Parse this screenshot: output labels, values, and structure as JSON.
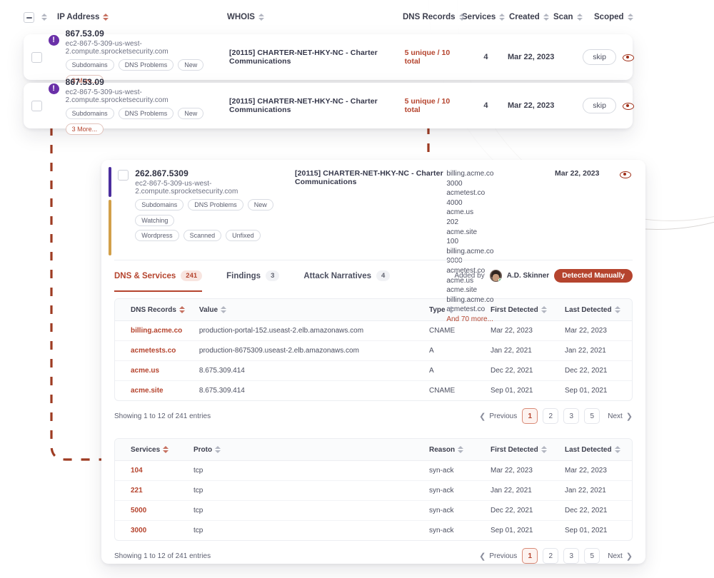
{
  "table_header": {
    "select_all_checkbox": "indeterminate",
    "columns": [
      {
        "label": "IP Address",
        "sort": "sortable-red"
      },
      {
        "label": "WHOIS",
        "sort": "sortable"
      },
      {
        "label": "DNS Records",
        "sort": "sortable"
      },
      {
        "label": "Services",
        "sort": "sortable"
      },
      {
        "label": "Created",
        "sort": "sortable"
      },
      {
        "label": "Scan",
        "sort": "sortable"
      },
      {
        "label": "Scoped",
        "sort": "sortable"
      }
    ]
  },
  "rows": [
    {
      "ip": "867.53.09",
      "hostname": "ec2-867-5-309-us-west-2.compute.sprocketsecurity.com",
      "tags": [
        "Subdomains",
        "DNS Problems",
        "New"
      ],
      "more_tag": "3 More...",
      "whois": "[20115] CHARTER-NET-HKY-NC - Charter Communications",
      "dns_records": "5 unique / 10 total",
      "services": "4",
      "created": "Mar 22, 2023",
      "scan": "skip",
      "scoped_icon": "eye-icon"
    },
    {
      "ip": "867.53.09",
      "hostname": "ec2-867-5-309-us-west-2.compute.sprocketsecurity.com",
      "tags": [
        "Subdomains",
        "DNS Problems",
        "New"
      ],
      "more_tag": "3 More...",
      "whois": "[20115] CHARTER-NET-HKY-NC - Charter Communications",
      "dns_records": "5 unique / 10 total",
      "services": "4",
      "created": "Mar 22, 2023",
      "scan": "skip",
      "scoped_icon": "eye-icon"
    }
  ],
  "detail": {
    "ip": "262.867.5309",
    "hostname": "ec2-867-5-309-us-west-2.compute.sprocketsecurity.com",
    "tags_row1": [
      "Subdomains",
      "DNS Problems",
      "New",
      "Watching"
    ],
    "tags_row2": [
      "Wordpress",
      "Scanned",
      "Unfixed"
    ],
    "whois": "[20115] CHARTER-NET-HKY-NC - Charter Communications",
    "created": "Mar 22, 2023",
    "scoped_icon": "eye-icon",
    "dns_list": [
      {
        "domain": "billing.acme.co",
        "port": "3000"
      },
      {
        "domain": "acmetest.co",
        "port": "4000"
      },
      {
        "domain": "acme.us",
        "port": "202"
      },
      {
        "domain": "acme.site",
        "port": "100"
      },
      {
        "domain": "billing.acme.co",
        "port": "9000"
      },
      {
        "domain": "acmetest.co",
        "port": ""
      },
      {
        "domain": "acme.us",
        "port": ""
      },
      {
        "domain": "acme.site",
        "port": ""
      },
      {
        "domain": "billing.acme.co",
        "port": ""
      },
      {
        "domain": "acmetest.co",
        "port": ""
      }
    ],
    "dns_list_more": "And 70 more...",
    "tabs": [
      {
        "label": "DNS & Services",
        "count": "241",
        "active": true
      },
      {
        "label": "Findings",
        "count": "3",
        "active": false
      },
      {
        "label": "Attack Narratives",
        "count": "4",
        "active": false
      }
    ],
    "added_by_label": "Added by",
    "added_by_name": "A.D. Skinner",
    "detected_badge": "Detected Manually",
    "dns_table": {
      "columns": [
        "DNS Records",
        "Value",
        "Type",
        "First Detected",
        "Last Detected"
      ],
      "rows": [
        [
          "billing.acme.co",
          "production-portal-152.useast-2.elb.amazonaws.com",
          "CNAME",
          "Mar 22, 2023",
          "Mar 22, 2023"
        ],
        [
          "acmetests.co",
          "production-8675309.useast-2.elb.amazonaws.com",
          "A",
          "Jan 22, 2021",
          "Jan 22, 2021"
        ],
        [
          "acme.us",
          "8.675.309.414",
          "A",
          "Dec 22, 2021",
          "Dec 22, 2021"
        ],
        [
          "acme.site",
          "8.675.309.414",
          "CNAME",
          "Sep 01, 2021",
          "Sep 01, 2021"
        ]
      ],
      "showing": "Showing 1 to 12 of 241 entries",
      "pagination": {
        "previous": "Previous",
        "pages": [
          "1",
          "2",
          "3",
          "5"
        ],
        "active_page": "1",
        "next": "Next"
      }
    },
    "services_table": {
      "columns": [
        "Services",
        "Proto",
        "Reason",
        "First Detected",
        "Last Detected"
      ],
      "rows": [
        [
          "104",
          "tcp",
          "syn-ack",
          "Mar 22, 2023",
          "Mar 22, 2023"
        ],
        [
          "221",
          "tcp",
          "syn-ack",
          "Jan 22, 2021",
          "Jan 22, 2021"
        ],
        [
          "5000",
          "tcp",
          "syn-ack",
          "Dec 22, 2021",
          "Dec 22, 2021"
        ],
        [
          "3000",
          "tcp",
          "syn-ack",
          "Sep 01, 2021",
          "Sep 01, 2021"
        ]
      ],
      "showing": "Showing 1 to 12 of 241 entries",
      "pagination": {
        "previous": "Previous",
        "pages": [
          "1",
          "2",
          "3",
          "5"
        ],
        "active_page": "1",
        "next": "Next"
      }
    }
  },
  "colors": {
    "accent_red": "#b5442e",
    "badge_purple": "#6A30A8",
    "accent_bar_purple": "#4B2E9E",
    "accent_bar_gold": "#D2A04A",
    "arc_salmon": "#dd9287",
    "dash_line": "#9e3b22"
  }
}
